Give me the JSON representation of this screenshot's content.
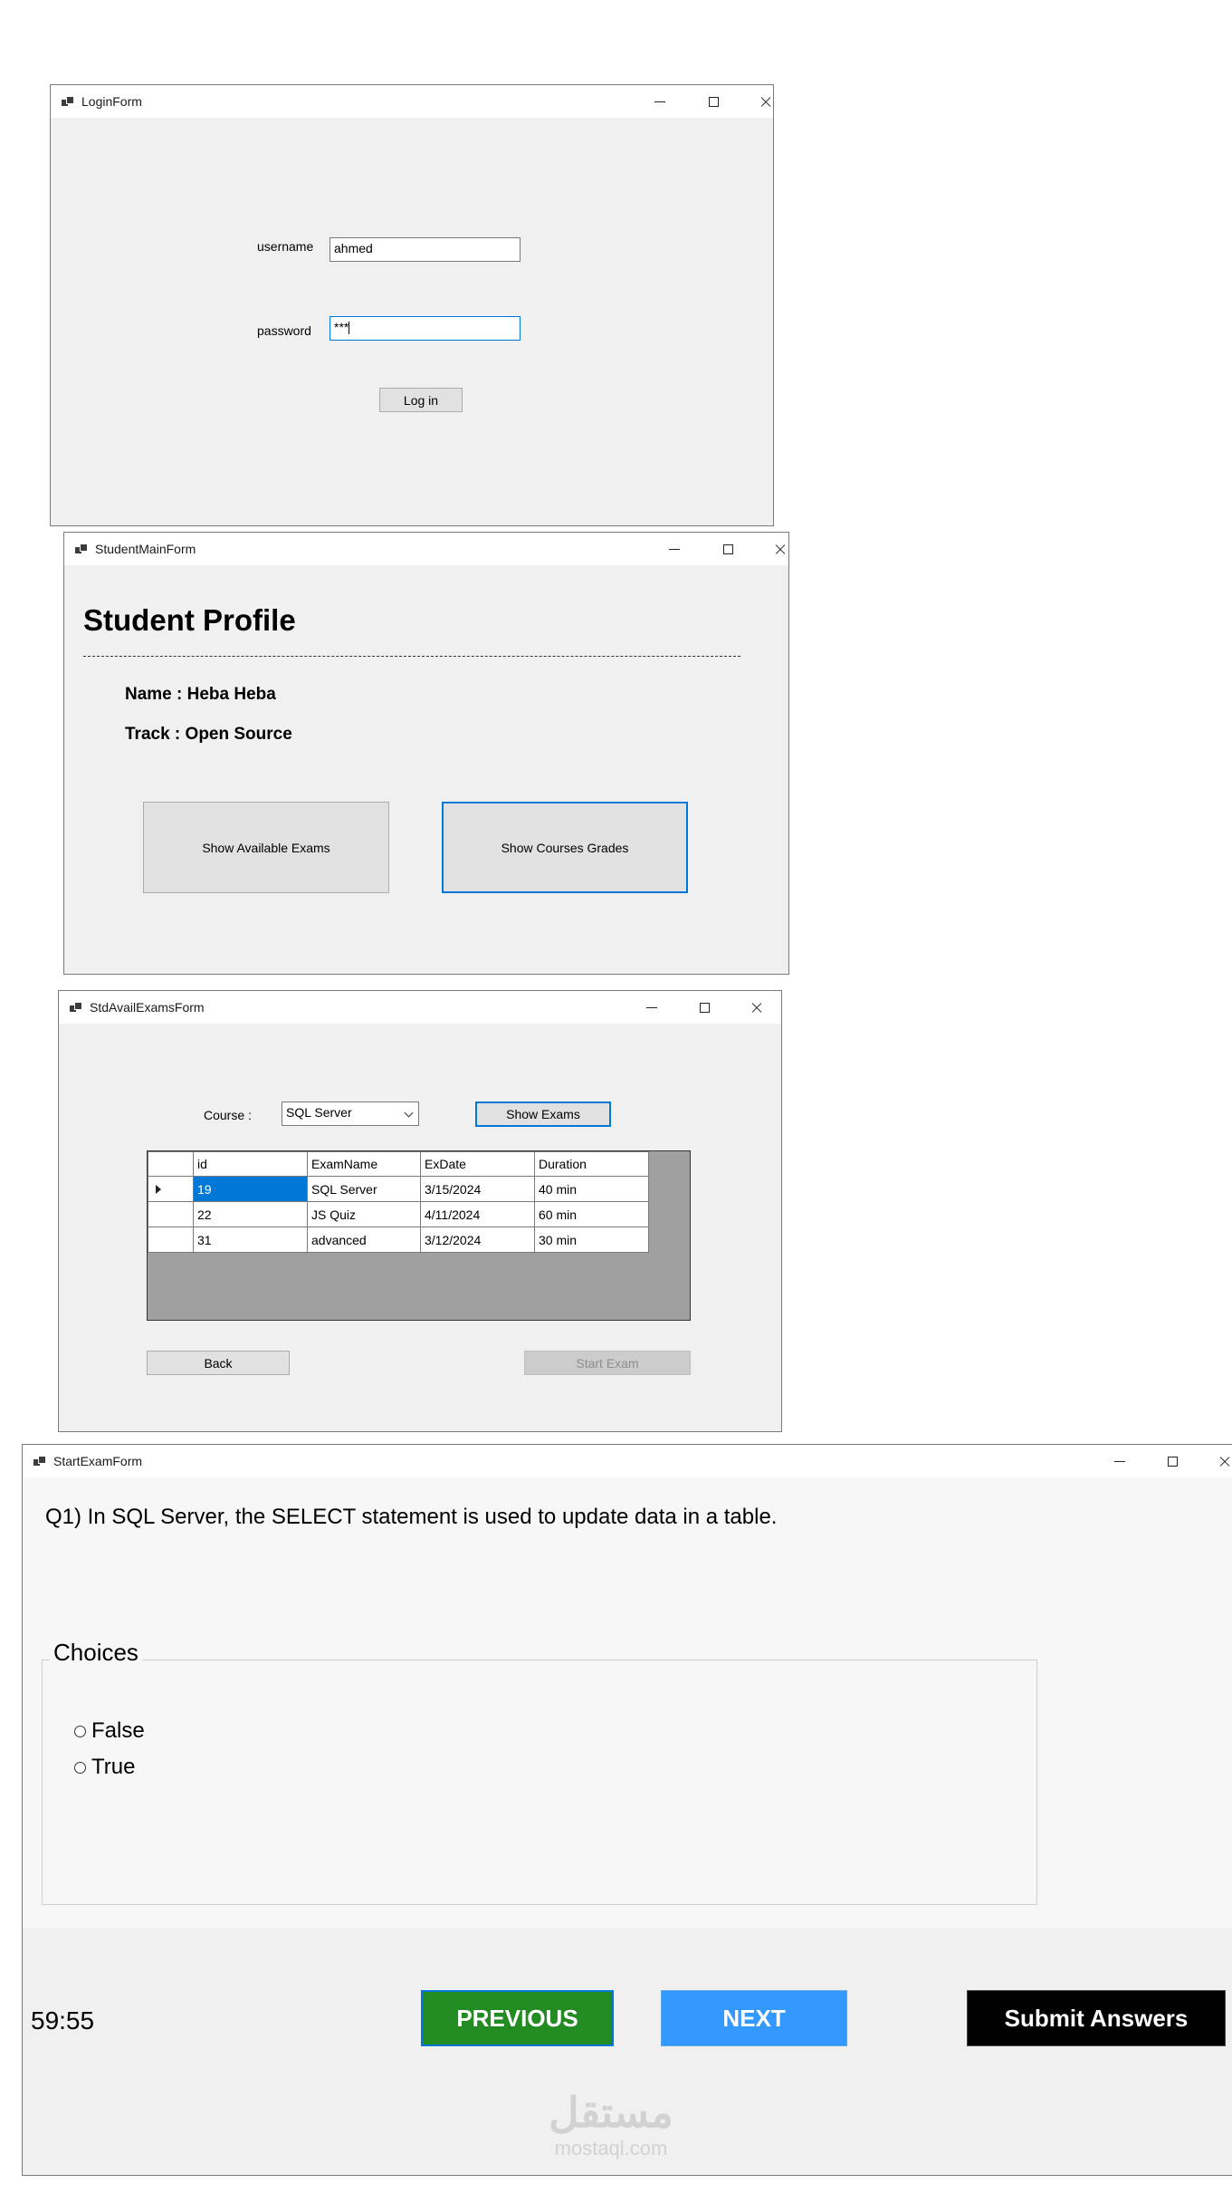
{
  "login_form": {
    "title": "LoginForm",
    "username_label": "username",
    "username_value": "ahmed",
    "password_label": "password",
    "password_value": "***",
    "login_button": "Log in"
  },
  "student_main_form": {
    "title": "StudentMainForm",
    "heading": "Student Profile",
    "name_line": "Name : Heba Heba",
    "track_line": "Track : Open Source",
    "show_exams_button": "Show Available Exams",
    "show_grades_button": "Show Courses Grades"
  },
  "avail_exams_form": {
    "title": "StdAvailExamsForm",
    "course_label": "Course :",
    "course_selected": "SQL Server",
    "show_exams_button": "Show Exams",
    "columns": [
      "id",
      "ExamName",
      "ExDate",
      "Duration"
    ],
    "rows": [
      [
        "19",
        "SQL Server",
        "3/15/2024",
        "40 min"
      ],
      [
        "22",
        "JS Quiz",
        "4/11/2024",
        "60 min"
      ],
      [
        "31",
        "advanced",
        "3/12/2024",
        "30 min"
      ]
    ],
    "back_button": "Back",
    "start_button": "Start Exam"
  },
  "start_exam_form": {
    "title": "StartExamForm",
    "question": "Q1) In SQL Server, the SELECT statement is used to update data in a table.",
    "choices_label": "Choices",
    "choices": [
      "False",
      "True"
    ],
    "timer": "59:55",
    "previous_button": "PREVIOUS",
    "next_button": "NEXT",
    "submit_button": "Submit Answers"
  },
  "watermark": {
    "arabic": "مستقل",
    "latin": "mostaql.com"
  },
  "colors": {
    "window_bg": "#f0f0f0",
    "selection_blue": "#0078d7",
    "previous_green": "#228b22",
    "next_blue": "#3399ff",
    "submit_black": "#000000",
    "grid_empty": "#a0a0a0"
  }
}
